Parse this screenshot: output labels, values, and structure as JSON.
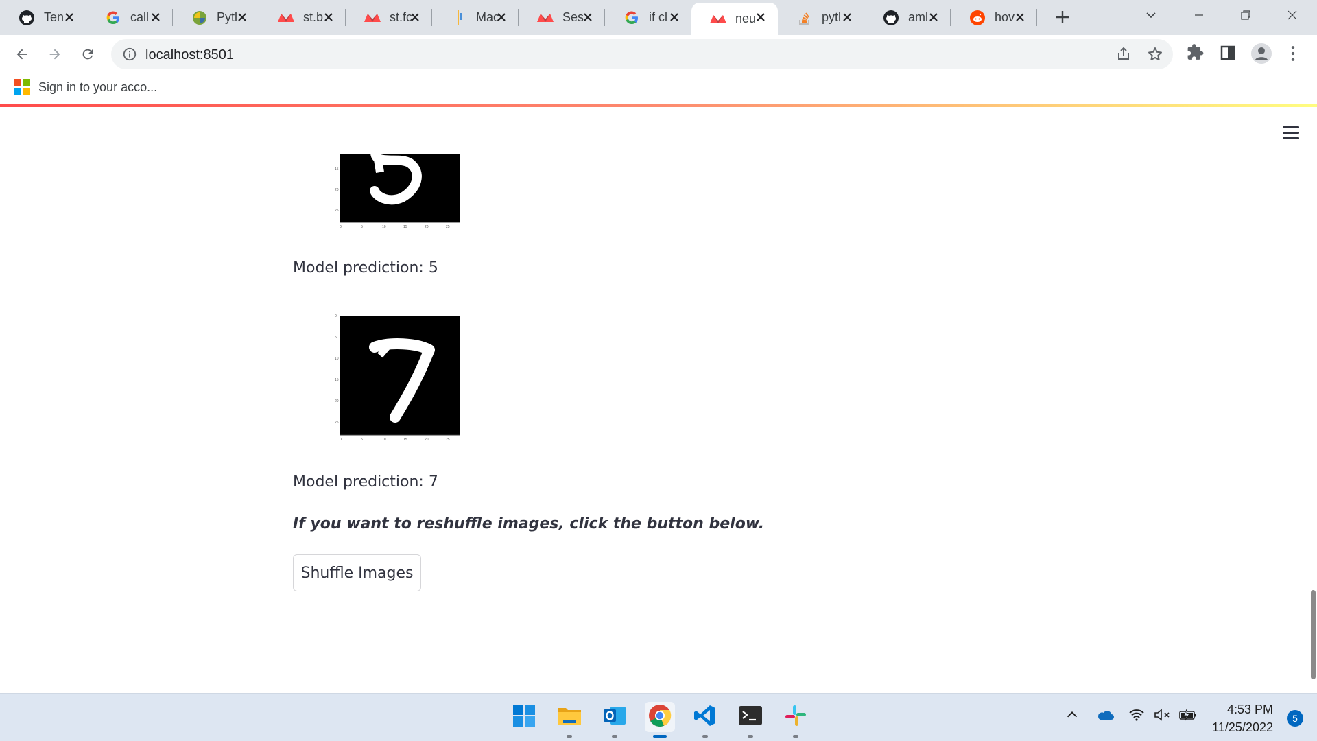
{
  "browser": {
    "tabs": [
      {
        "title": "Ten",
        "icon": "github-icon",
        "active": false
      },
      {
        "title": "call",
        "icon": "google-icon",
        "active": false
      },
      {
        "title": "Pytl",
        "icon": "python-icon",
        "active": false
      },
      {
        "title": "st.b",
        "icon": "streamlit-icon",
        "active": false
      },
      {
        "title": "st.fc",
        "icon": "streamlit-icon",
        "active": false
      },
      {
        "title": "Mac",
        "icon": "bookmark-icon",
        "active": false
      },
      {
        "title": "Ses",
        "icon": "streamlit-icon",
        "active": false
      },
      {
        "title": "if cl",
        "icon": "google-icon",
        "active": false
      },
      {
        "title": "neu",
        "icon": "streamlit-icon",
        "active": true
      },
      {
        "title": "pytl",
        "icon": "stackoverflow-icon",
        "active": false
      },
      {
        "title": "aml",
        "icon": "github-icon",
        "active": false
      },
      {
        "title": "hov",
        "icon": "reddit-icon",
        "active": false
      }
    ],
    "url": "localhost:8501",
    "bookmark_label": "Sign in to your acco..."
  },
  "colors": {
    "accent": "#ff4b4b",
    "text": "#31333f",
    "chrome_bg": "#dfe3e8",
    "taskbar_bg": "#dde6f2"
  },
  "app": {
    "image1": {
      "digit": "5",
      "y_ticks": [
        "15",
        "20",
        "25"
      ],
      "x_ticks": [
        "0",
        "5",
        "10",
        "15",
        "20",
        "25"
      ]
    },
    "prediction1": "Model prediction: 5",
    "image2": {
      "digit": "7",
      "y_ticks": [
        "0",
        "5",
        "10",
        "15",
        "20",
        "25"
      ],
      "x_ticks": [
        "0",
        "5",
        "10",
        "15",
        "20",
        "25"
      ]
    },
    "prediction2": "Model prediction: 7",
    "instruction": "If you want to reshuffle images, click the button below.",
    "button_label": "Shuffle Images"
  },
  "taskbar": {
    "apps": [
      "windows-start-icon",
      "file-explorer-icon",
      "outlook-icon",
      "chrome-icon",
      "vscode-icon",
      "terminal-icon",
      "slack-icon"
    ],
    "time": "4:53 PM",
    "date": "11/25/2022",
    "notification_count": "5"
  }
}
